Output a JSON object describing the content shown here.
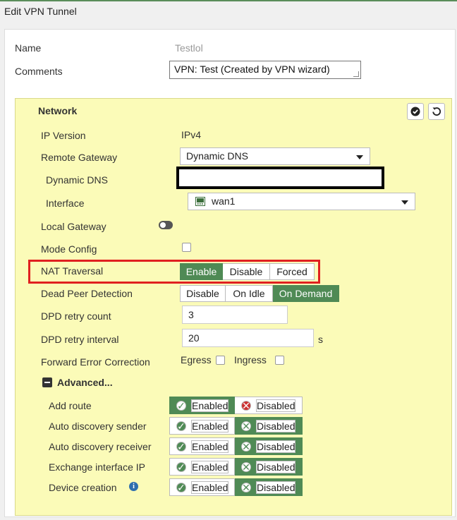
{
  "window": {
    "title": "Edit VPN Tunnel"
  },
  "form": {
    "name_label": "Name",
    "name_value": "Testlol",
    "comments_label": "Comments",
    "comments_value": "VPN: Test (Created by VPN wizard)"
  },
  "network": {
    "title": "Network",
    "ip_version_label": "IP Version",
    "ip_version_value": "IPv4",
    "remote_gateway_label": "Remote Gateway",
    "remote_gateway_value": "Dynamic DNS",
    "dynamic_dns_label": "Dynamic DNS",
    "dynamic_dns_value": "",
    "interface_label": "Interface",
    "interface_value": "wan1",
    "local_gateway_label": "Local Gateway",
    "local_gateway_enabled": false,
    "mode_config_label": "Mode Config",
    "mode_config_checked": false,
    "nat_traversal_label": "NAT Traversal",
    "nat_traversal_options": [
      "Enable",
      "Disable",
      "Forced"
    ],
    "nat_traversal_selected": "Enable",
    "dpd_label": "Dead Peer Detection",
    "dpd_options": [
      "Disable",
      "On Idle",
      "On Demand"
    ],
    "dpd_selected": "On Demand",
    "dpd_retry_count_label": "DPD retry count",
    "dpd_retry_count_value": "3",
    "dpd_retry_interval_label": "DPD retry interval",
    "dpd_retry_interval_value": "20",
    "dpd_retry_interval_unit": "s",
    "fec_label": "Forward Error Correction",
    "fec_egress_label": "Egress",
    "fec_ingress_label": "Ingress",
    "fec_egress_checked": false,
    "fec_ingress_checked": false
  },
  "advanced": {
    "title": "Advanced...",
    "enabled_label": "Enabled",
    "disabled_label": "Disabled",
    "rows": [
      {
        "label": "Add route",
        "state": "Enabled"
      },
      {
        "label": "Auto discovery sender",
        "state": "Disabled"
      },
      {
        "label": "Auto discovery receiver",
        "state": "Disabled"
      },
      {
        "label": "Exchange interface IP",
        "state": "Disabled"
      },
      {
        "label": "Device creation",
        "state": "Disabled"
      }
    ]
  },
  "colors": {
    "accent_green": "#4f8a55",
    "panel_yellow": "#fbfbb8",
    "highlight_red": "#e02020"
  }
}
